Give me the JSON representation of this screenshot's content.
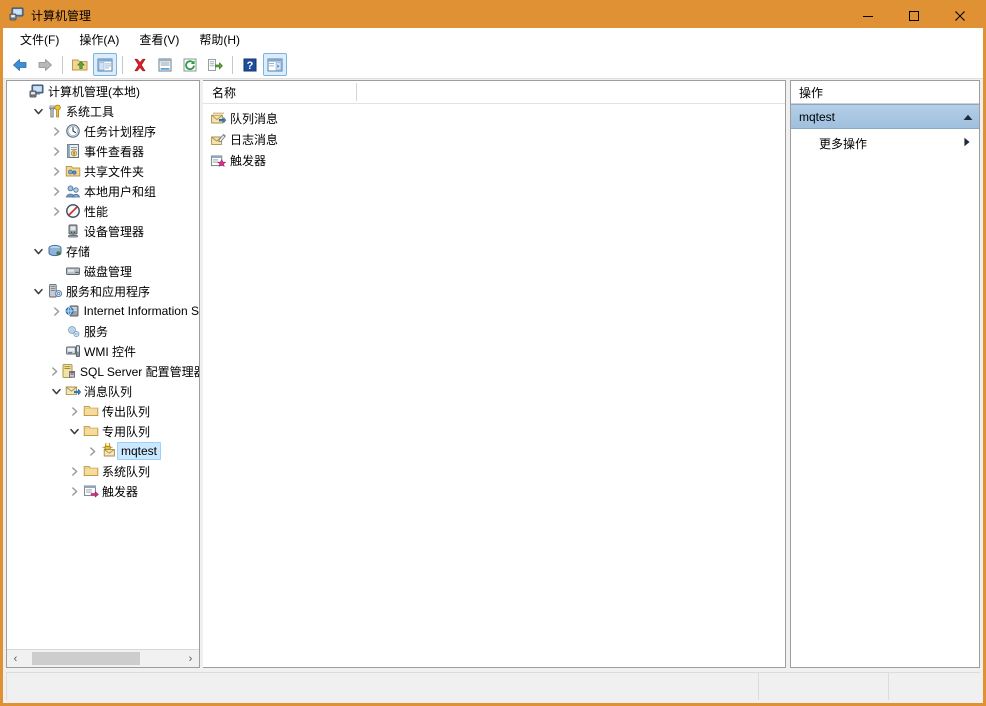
{
  "window": {
    "title": "计算机管理",
    "title_icon": "computer-management-icon",
    "accent_color": "#df9134",
    "controls": [
      {
        "name": "minimize",
        "glyph": "minimize-icon"
      },
      {
        "name": "maximize",
        "glyph": "maximize-icon"
      },
      {
        "name": "close",
        "glyph": "close-icon"
      }
    ]
  },
  "menubar": {
    "items": [
      {
        "label": "文件(F)",
        "name": "menu-file"
      },
      {
        "label": "操作(A)",
        "name": "menu-action"
      },
      {
        "label": "查看(V)",
        "name": "menu-view"
      },
      {
        "label": "帮助(H)",
        "name": "menu-help"
      }
    ]
  },
  "toolbar": {
    "buttons": [
      {
        "name": "back-icon",
        "checked": false
      },
      {
        "name": "forward-icon",
        "checked": false
      },
      {
        "name": "separator",
        "checked": false
      },
      {
        "name": "up-folder-icon",
        "checked": false
      },
      {
        "name": "show-hide-console-tree-icon",
        "checked": true
      },
      {
        "name": "separator",
        "checked": false
      },
      {
        "name": "delete-icon",
        "checked": false
      },
      {
        "name": "properties-icon",
        "checked": false
      },
      {
        "name": "refresh-icon",
        "checked": false
      },
      {
        "name": "export-list-icon",
        "checked": false
      },
      {
        "name": "separator",
        "checked": false
      },
      {
        "name": "help-icon",
        "checked": false
      },
      {
        "name": "show-action-pane-icon",
        "checked": true
      }
    ]
  },
  "tree": {
    "nodes": [
      {
        "label": "计算机管理(本地)",
        "depth": 0,
        "expander": "none",
        "icon": "computer-icon",
        "selected": false
      },
      {
        "label": "系统工具",
        "depth": 1,
        "expander": "expanded",
        "icon": "system-tools-icon",
        "selected": false
      },
      {
        "label": "任务计划程序",
        "depth": 2,
        "expander": "collapsed",
        "icon": "task-scheduler-icon",
        "selected": false
      },
      {
        "label": "事件查看器",
        "depth": 2,
        "expander": "collapsed",
        "icon": "event-viewer-icon",
        "selected": false
      },
      {
        "label": "共享文件夹",
        "depth": 2,
        "expander": "collapsed",
        "icon": "shared-folders-icon",
        "selected": false
      },
      {
        "label": "本地用户和组",
        "depth": 2,
        "expander": "collapsed",
        "icon": "local-users-groups-icon",
        "selected": false
      },
      {
        "label": "性能",
        "depth": 2,
        "expander": "collapsed",
        "icon": "performance-icon",
        "selected": false
      },
      {
        "label": "设备管理器",
        "depth": 2,
        "expander": "none",
        "icon": "device-manager-icon",
        "selected": false
      },
      {
        "label": "存储",
        "depth": 1,
        "expander": "expanded",
        "icon": "storage-icon",
        "selected": false
      },
      {
        "label": "磁盘管理",
        "depth": 2,
        "expander": "none",
        "icon": "disk-management-icon",
        "selected": false
      },
      {
        "label": "服务和应用程序",
        "depth": 1,
        "expander": "expanded",
        "icon": "services-apps-icon",
        "selected": false
      },
      {
        "label": "Internet Information S",
        "depth": 2,
        "expander": "collapsed",
        "icon": "iis-icon",
        "selected": false
      },
      {
        "label": "服务",
        "depth": 2,
        "expander": "none",
        "icon": "services-icon",
        "selected": false
      },
      {
        "label": "WMI 控件",
        "depth": 2,
        "expander": "none",
        "icon": "wmi-control-icon",
        "selected": false
      },
      {
        "label": "SQL Server 配置管理器",
        "depth": 2,
        "expander": "collapsed",
        "icon": "sql-server-icon",
        "selected": false
      },
      {
        "label": "消息队列",
        "depth": 2,
        "expander": "expanded",
        "icon": "message-queuing-icon",
        "selected": false
      },
      {
        "label": "传出队列",
        "depth": 3,
        "expander": "collapsed",
        "icon": "folder-icon",
        "selected": false
      },
      {
        "label": "专用队列",
        "depth": 3,
        "expander": "expanded",
        "icon": "folder-icon",
        "selected": false
      },
      {
        "label": "mqtest",
        "depth": 4,
        "expander": "collapsed",
        "icon": "queue-icon",
        "selected": true
      },
      {
        "label": "系统队列",
        "depth": 3,
        "expander": "collapsed",
        "icon": "folder-icon",
        "selected": false
      },
      {
        "label": "触发器",
        "depth": 3,
        "expander": "collapsed",
        "icon": "trigger-icon",
        "selected": false
      }
    ],
    "hscrollbar": {
      "left_arrow": "‹",
      "right_arrow": "›"
    }
  },
  "list": {
    "columns": [
      "名称"
    ],
    "rows": [
      {
        "label": "队列消息",
        "icon": "queue-messages-icon"
      },
      {
        "label": "日志消息",
        "icon": "journal-messages-icon"
      },
      {
        "label": "触发器",
        "icon": "triggers-icon"
      }
    ]
  },
  "actions": {
    "title": "操作",
    "group_label": "mqtest",
    "group_collapse_icon": "chevron-up-icon",
    "items": [
      {
        "label": "更多操作",
        "submenu_icon": "chevron-right-icon",
        "name": "more-actions"
      }
    ]
  },
  "statusbar": {
    "cells": [
      "",
      "",
      ""
    ]
  }
}
